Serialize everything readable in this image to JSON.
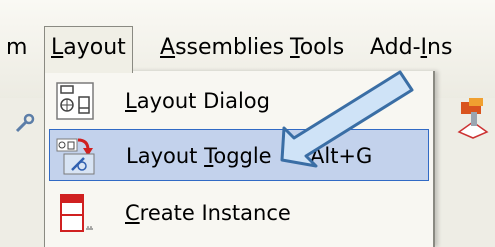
{
  "menubar": {
    "items": [
      {
        "pre": "",
        "mnemonic": "",
        "post": "m"
      },
      {
        "pre": "",
        "mnemonic": "L",
        "post": "ayout"
      },
      {
        "pre": "",
        "mnemonic": "A",
        "post": "ssemblies"
      },
      {
        "pre": "",
        "mnemonic": "T",
        "post": "ools"
      },
      {
        "pre": "Add-",
        "mnemonic": "I",
        "post": "ns"
      }
    ]
  },
  "layout_menu": {
    "items": [
      {
        "pre": "",
        "mnemonic": "L",
        "post": "ayout Dialog",
        "shortcut": ""
      },
      {
        "pre": "Layout ",
        "mnemonic": "T",
        "post": "oggle",
        "shortcut": "Alt+G"
      },
      {
        "pre": "",
        "mnemonic": "C",
        "post": "reate Instance",
        "shortcut": ""
      }
    ]
  },
  "colors": {
    "highlight_bg": "#c3d2ec",
    "highlight_border": "#316ac5",
    "annotation_arrow_fill": "#cfe3f7",
    "annotation_arrow_stroke": "#3a6ea5"
  },
  "icons": {
    "layout_dialog": "layout-dialog-icon",
    "layout_toggle": "layout-toggle-icon",
    "create_instance": "create-instance-icon"
  }
}
